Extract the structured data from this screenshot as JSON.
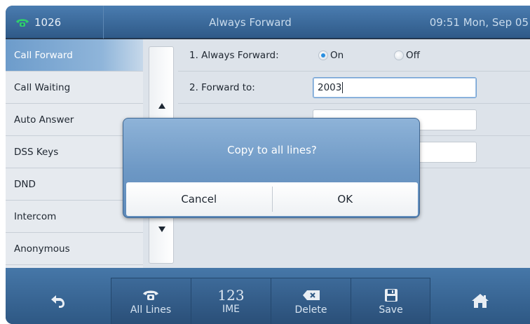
{
  "titlebar": {
    "account": "1026",
    "title": "Always Forward",
    "clock": "09:51 Mon, Sep 05",
    "icon": "phone-icon"
  },
  "sidebar": {
    "items": [
      {
        "label": "Call Forward",
        "active": true
      },
      {
        "label": "Call Waiting"
      },
      {
        "label": "Auto Answer"
      },
      {
        "label": "DSS Keys"
      },
      {
        "label": "DND"
      },
      {
        "label": "Intercom"
      },
      {
        "label": "Anonymous"
      }
    ]
  },
  "form": {
    "always_forward_label": "1. Always Forward:",
    "on_label": "On",
    "off_label": "Off",
    "selected": "On",
    "forward_to_label": "2. Forward to:",
    "forward_to_value": "2003"
  },
  "dialog": {
    "message": "Copy to all lines?",
    "cancel": "Cancel",
    "ok": "OK"
  },
  "softkeys": {
    "back_icon": "back-icon",
    "all_lines": "All Lines",
    "ime_value": "123",
    "ime": "IME",
    "delete": "Delete",
    "save": "Save",
    "home_icon": "home-icon"
  },
  "colors": {
    "titlebar": "#3a6898",
    "accent": "#2a8fe0",
    "dialog": "#6c97c4"
  }
}
